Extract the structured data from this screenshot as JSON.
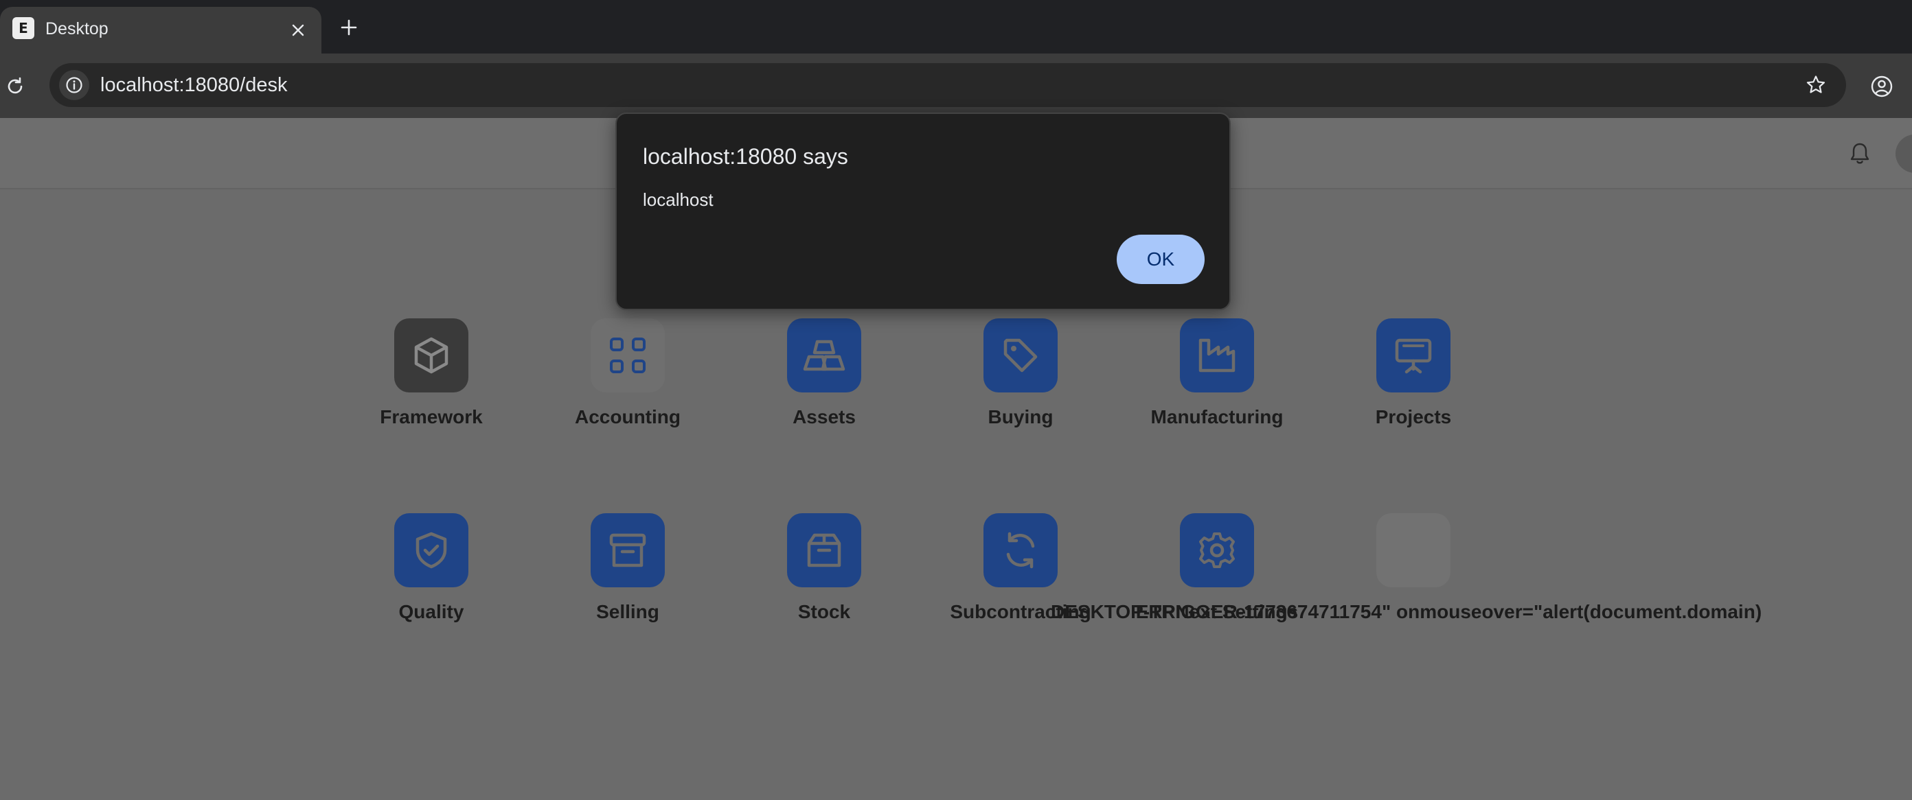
{
  "browser": {
    "tab_title": "Desktop",
    "tab_favicon_letter": "E",
    "url": "localhost:18080/desk"
  },
  "apps": [
    {
      "label": "Framework",
      "icon": "cube-icon",
      "style": "dark"
    },
    {
      "label": "Accounting",
      "icon": "grid-icon",
      "style": "pale"
    },
    {
      "label": "Assets",
      "icon": "gold-bars-icon",
      "style": "blue"
    },
    {
      "label": "Buying",
      "icon": "tag-icon",
      "style": "blue"
    },
    {
      "label": "Manufacturing",
      "icon": "factory-icon",
      "style": "blue"
    },
    {
      "label": "Projects",
      "icon": "presentation-board-icon",
      "style": "blue"
    },
    {
      "label": "Quality",
      "icon": "shield-check-icon",
      "style": "blue"
    },
    {
      "label": "Selling",
      "icon": "archive-box-icon",
      "style": "blue"
    },
    {
      "label": "Stock",
      "icon": "package-icon",
      "style": "blue"
    },
    {
      "label": "Subcontracting",
      "icon": "refresh-icon",
      "style": "blue"
    },
    {
      "label": "ERPNext Settings",
      "icon": "gear-icon",
      "style": "blue"
    },
    {
      "label": "DESKTOP-TRIGGER-1773674711754\" onmouseover=\"alert(document.domain)",
      "icon": "blank-icon",
      "style": "ghost"
    }
  ],
  "dialog": {
    "title": "localhost:18080 says",
    "message": "localhost",
    "ok_label": "OK"
  },
  "colors": {
    "app_icon_blue": "#1f4487",
    "dialog_background": "#1f1f1f",
    "ok_button": "#a8c7fa"
  }
}
